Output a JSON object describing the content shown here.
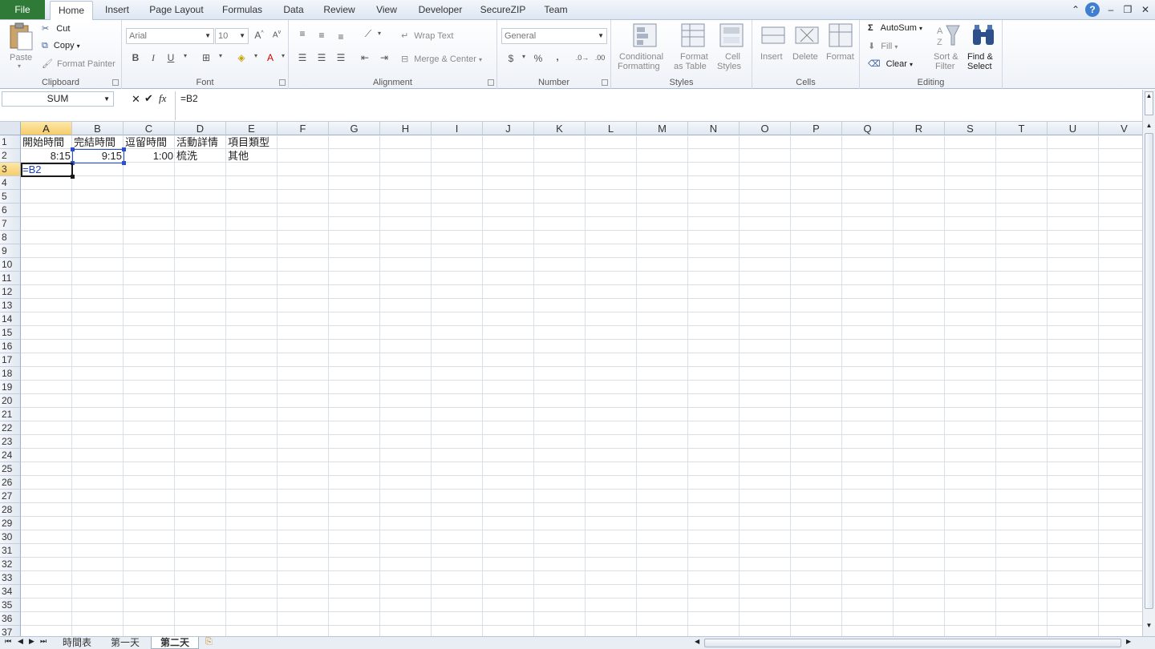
{
  "ribbon_tabs": {
    "file": "File",
    "home": "Home",
    "insert": "Insert",
    "page_layout": "Page Layout",
    "formulas": "Formulas",
    "data": "Data",
    "review": "Review",
    "view": "View",
    "developer": "Developer",
    "securezip": "SecureZIP",
    "team": "Team"
  },
  "clipboard": {
    "paste": "Paste",
    "cut": "Cut",
    "copy": "Copy",
    "format_painter": "Format Painter",
    "label": "Clipboard"
  },
  "font": {
    "name": "Arial",
    "size": "10",
    "bold": "B",
    "italic": "I",
    "underline": "U",
    "label": "Font"
  },
  "alignment": {
    "wrap_text": "Wrap Text",
    "merge_center": "Merge & Center",
    "label": "Alignment"
  },
  "number": {
    "format": "General",
    "currency": "$",
    "percent": "%",
    "comma": ",",
    "label": "Number"
  },
  "styles": {
    "conditional_1": "Conditional",
    "conditional_2": "Formatting",
    "format_table_1": "Format",
    "format_table_2": "as Table",
    "cell_styles_1": "Cell",
    "cell_styles_2": "Styles",
    "label": "Styles"
  },
  "cells": {
    "insert": "Insert",
    "delete": "Delete",
    "format": "Format",
    "label": "Cells"
  },
  "editing": {
    "autosum": "AutoSum",
    "fill": "Fill",
    "clear": "Clear",
    "sort_1": "Sort &",
    "sort_2": "Filter",
    "find_1": "Find &",
    "find_2": "Select",
    "label": "Editing"
  },
  "formula_bar": {
    "name_box": "SUM",
    "formula": "=B2"
  },
  "columns": [
    "A",
    "B",
    "C",
    "D",
    "E",
    "F",
    "G",
    "H",
    "I",
    "J",
    "K",
    "L",
    "M",
    "N",
    "O",
    "P",
    "Q",
    "R",
    "S",
    "T",
    "U",
    "V"
  ],
  "rows": [
    "1",
    "2",
    "3",
    "4",
    "5",
    "6",
    "7",
    "8",
    "9",
    "10",
    "11",
    "12",
    "13",
    "14",
    "15",
    "16",
    "17",
    "18",
    "19",
    "20",
    "21",
    "22",
    "23",
    "24",
    "25",
    "26",
    "27",
    "28",
    "29",
    "30",
    "31",
    "32",
    "33",
    "34",
    "35",
    "36",
    "37"
  ],
  "cells_data": {
    "A1": "開始時間",
    "B1": "完結時間",
    "C1": "逗留時間",
    "D1": "活動詳情",
    "E1": "項目類型",
    "A2": "8:15",
    "B2": "9:15",
    "C2": "1:00",
    "D2": "梳洗",
    "E2": "其他",
    "A3": "=B2"
  },
  "sheet_tabs": {
    "tab1": "時間表",
    "tab2": "第一天",
    "tab3": "第二天"
  }
}
